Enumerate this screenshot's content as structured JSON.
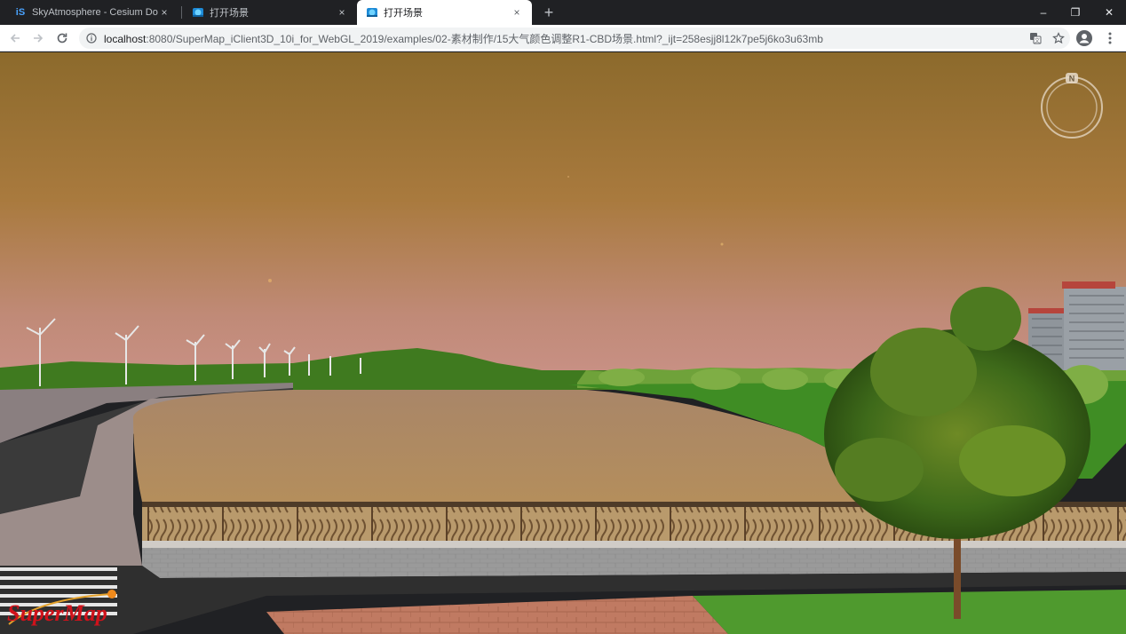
{
  "tabs": [
    {
      "title": "SkyAtmosphere - Cesium Doc",
      "favicon": "iS",
      "active": false
    },
    {
      "title": "打开场景",
      "favicon": "supermap-globe-icon",
      "active": false
    },
    {
      "title": "打开场景",
      "favicon": "supermap-globe-icon",
      "active": true
    }
  ],
  "tab_close_glyph": "×",
  "new_tab_glyph": "+",
  "window_controls": {
    "minimize": "–",
    "restore": "❐",
    "close": "✕"
  },
  "address": {
    "host": "localhost",
    "rest": ":8080/SuperMap_iClient3D_10i_for_WebGL_2019/examples/02-素材制作/15大气颜色调整R1-CBD场景.html?_ijt=258esjj8l12k7pe5j6ko3u63mb"
  },
  "scene": {
    "compass_label": "N",
    "logo_text": "SuperMap",
    "colors": {
      "sky_top": "#8c6a2c",
      "sky_bottom": "#c08a77",
      "water": "#b48e5c",
      "grass": "#3f8d24"
    }
  }
}
